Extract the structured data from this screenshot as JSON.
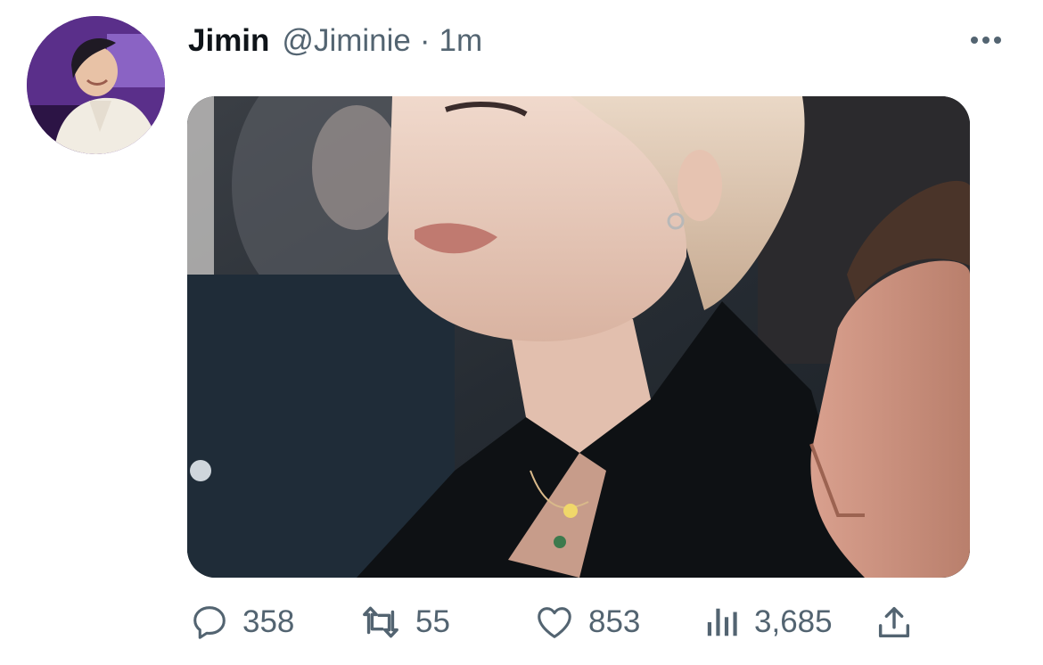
{
  "tweet": {
    "display_name": "Jimin",
    "handle": "@Jiminie",
    "separator": "·",
    "time": "1m"
  },
  "actions": {
    "replies": "358",
    "retweets": "55",
    "likes": "853",
    "views": "3,685"
  },
  "icons": {
    "more": "more-horizontal-icon",
    "reply": "speech-bubble-icon",
    "retweet": "retweet-arrows-icon",
    "like": "heart-icon",
    "views": "bar-chart-icon",
    "share": "share-upload-icon"
  },
  "colors": {
    "text_primary": "#0f1419",
    "text_secondary": "#536471",
    "background": "#ffffff"
  }
}
